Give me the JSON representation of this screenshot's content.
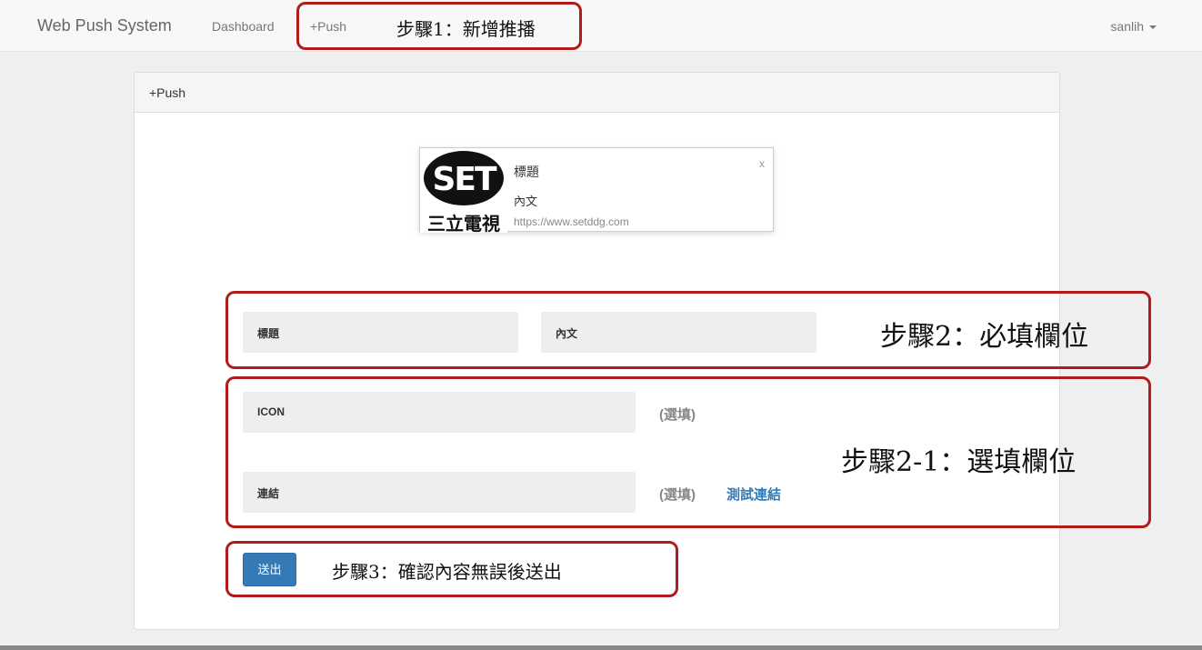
{
  "navbar": {
    "brand": "Web Push System",
    "links": [
      "Dashboard",
      "+Push"
    ],
    "user": "sanlih"
  },
  "panel": {
    "heading": "+Push"
  },
  "preview": {
    "logo_text": "SET",
    "logo_caption": "三立電視",
    "title": "標題",
    "body": "內文",
    "url": "https://www.setddg.com",
    "close": "x"
  },
  "form": {
    "title_label": "標題",
    "body_label": "內文",
    "icon_label": "ICON",
    "link_label": "連結",
    "optional_hint": "(選填)",
    "test_link": "測試連結",
    "submit": "送出"
  },
  "annotations": {
    "step1": "步驟1：新增推播",
    "step2": "步驟2：必填欄位",
    "step2_1": "步驟2-1：選填欄位",
    "step3": "步驟3：確認內容無誤後送出"
  },
  "colors": {
    "primary": "#337ab7",
    "annotation": "#b01c1c"
  }
}
